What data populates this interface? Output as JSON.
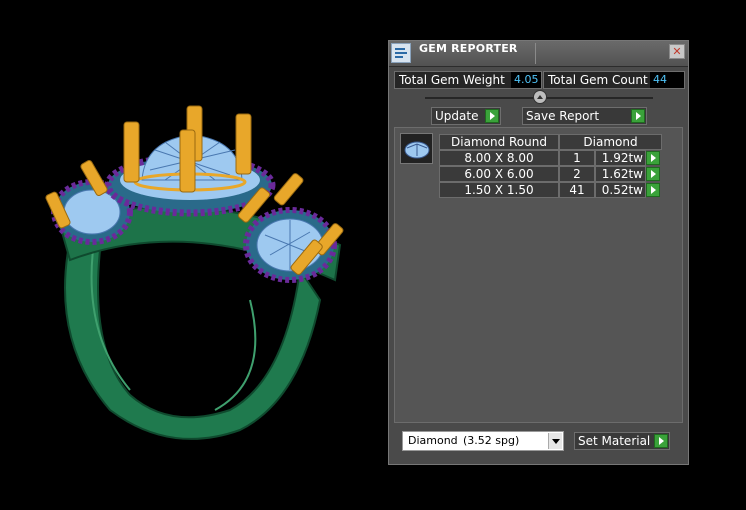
{
  "viewport": {
    "model": "three-stone halo ring"
  },
  "panel": {
    "title": "GEM REPORTER",
    "icons": {
      "app": "gem-reporter-icon",
      "close": "close-icon"
    },
    "close_label": "✕",
    "total_weight": {
      "label": "Total Gem Weight",
      "value": "4.05"
    },
    "total_count": {
      "label": "Total Gem Count",
      "value": "44"
    },
    "update_label": "Update",
    "save_report_label": "Save Report",
    "table": {
      "headers": [
        "Diamond Round",
        "Diamond"
      ],
      "rows": [
        {
          "size": "8.00 X 8.00",
          "count": "1",
          "weight": "1.92tw"
        },
        {
          "size": "6.00 X 6.00",
          "count": "2",
          "weight": "1.62tw"
        },
        {
          "size": "1.50 X 1.50",
          "count": "41",
          "weight": "0.52tw"
        }
      ]
    },
    "material": {
      "name": "Diamond",
      "spg": "(3.52 spg)"
    },
    "set_material_label": "Set Material",
    "colors": {
      "value_text": "#4fc3f7",
      "go_button": "#3aa23a",
      "ring": "#1f7a4e",
      "prongs": "#e8a72a",
      "gems": "#9ec9f0",
      "accent_gems": "#6a2a9a"
    }
  }
}
